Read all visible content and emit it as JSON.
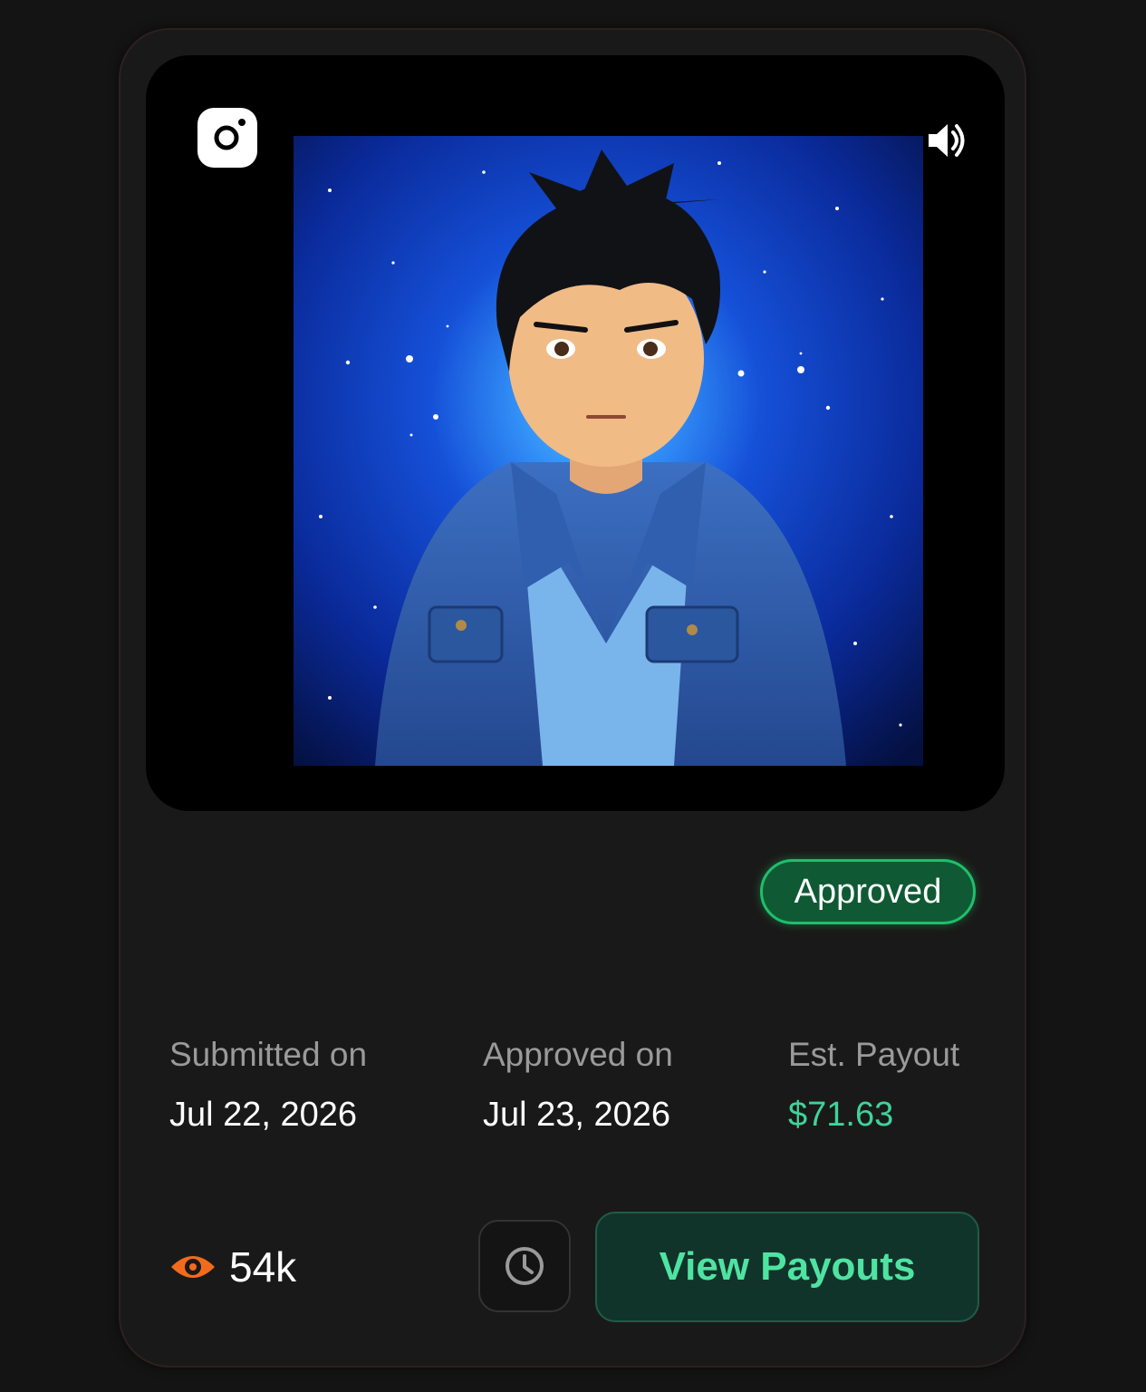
{
  "media": {
    "platform_icon": "instagram-icon",
    "sound_icon": "speaker-icon",
    "artwork_subject": "anime-style young man in denim jacket against starry blue space"
  },
  "status": {
    "label": "Approved",
    "color": "#1fbf6a"
  },
  "details": {
    "submitted": {
      "label": "Submitted on",
      "value": "Jul 22, 2026"
    },
    "approved": {
      "label": "Approved on",
      "value": "Jul 23, 2026"
    },
    "payout": {
      "label": "Est. Payout",
      "value": "$71.63",
      "color": "#3fd39a"
    }
  },
  "stats": {
    "views_icon": "eye-icon",
    "views": "54k"
  },
  "actions": {
    "history_icon": "clock-icon",
    "payouts_label": "View Payouts"
  },
  "colors": {
    "accent": "#4fe3a2",
    "eye": "#f26b1d",
    "background": "#141414"
  }
}
